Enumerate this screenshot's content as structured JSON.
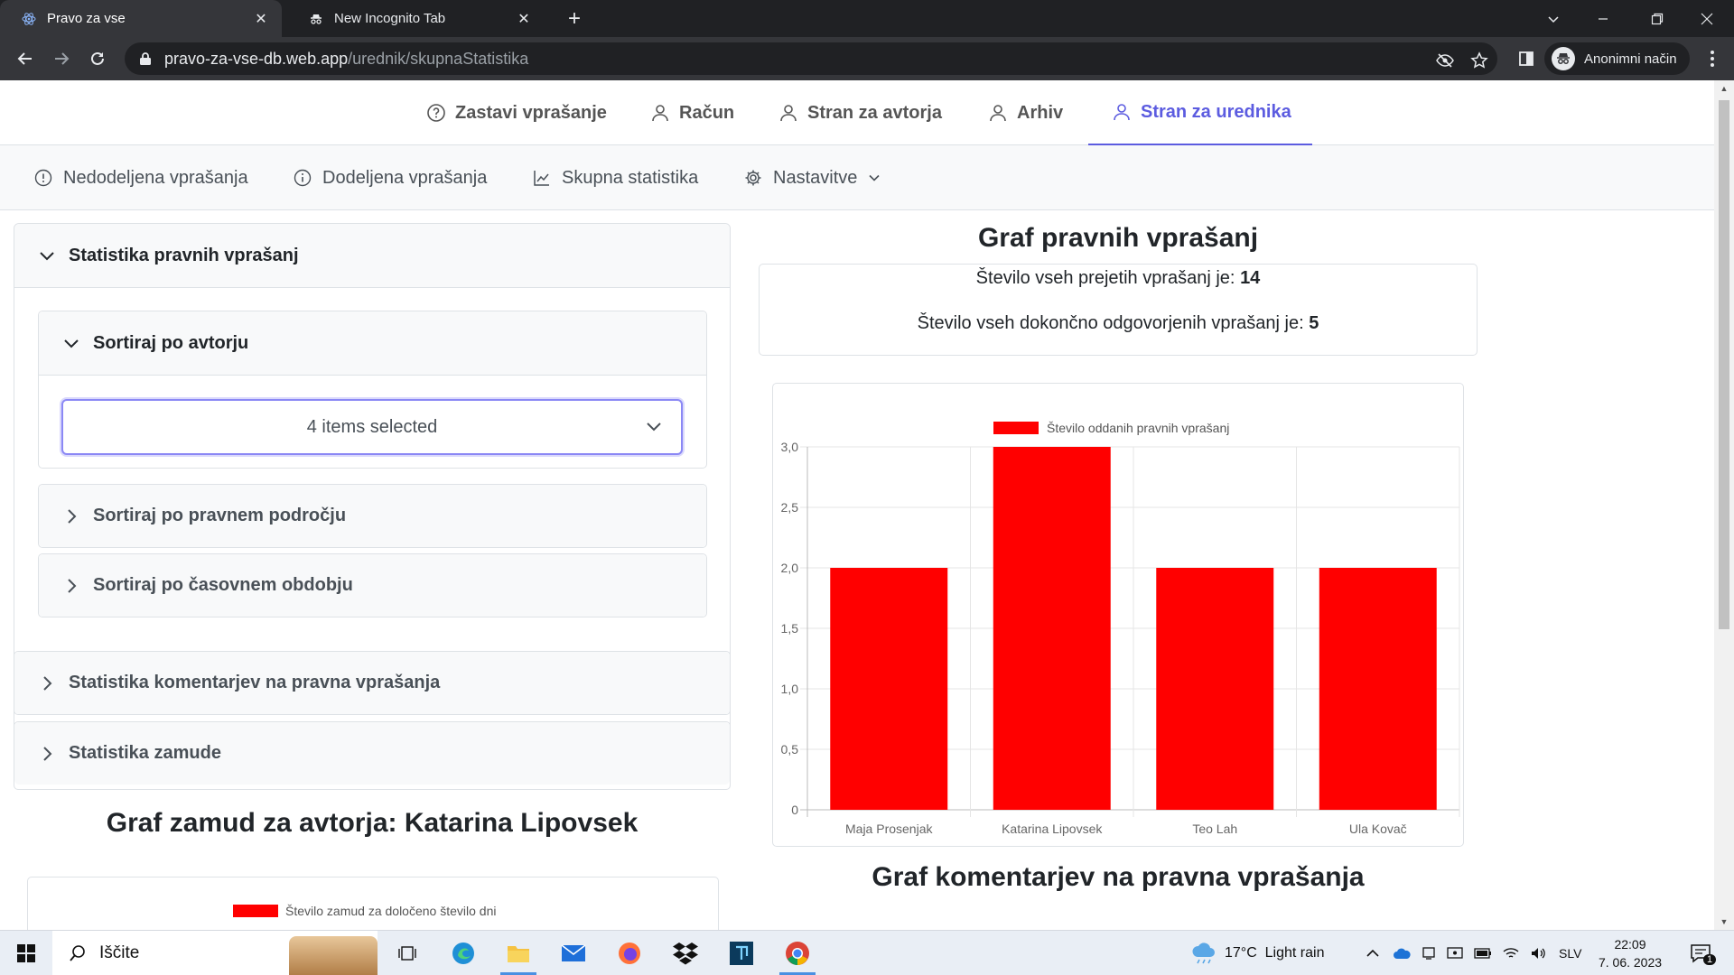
{
  "browser": {
    "tabs": [
      {
        "title": "Pravo za vse",
        "active": true
      },
      {
        "title": "New Incognito Tab",
        "active": false
      }
    ],
    "url_host": "pravo-za-vse-db.web.app",
    "url_path": "/urednik/skupnaStatistika",
    "incognito_label": "Anonimni način"
  },
  "main_nav": [
    {
      "label": "Zastavi vprašanje",
      "icon": "question-circle-icon"
    },
    {
      "label": "Račun",
      "icon": "user-icon"
    },
    {
      "label": "Stran za avtorja",
      "icon": "user-icon"
    },
    {
      "label": "Arhiv",
      "icon": "user-icon"
    },
    {
      "label": "Stran za urednika",
      "icon": "user-icon",
      "active": true
    }
  ],
  "sub_nav": [
    {
      "label": "Nedodeljena vprašanja",
      "icon": "alert-circle-icon"
    },
    {
      "label": "Dodeljena vprašanja",
      "icon": "info-circle-icon"
    },
    {
      "label": "Skupna statistika",
      "icon": "line-chart-icon"
    },
    {
      "label": "Nastavitve",
      "icon": "gear-icon",
      "dropdown": true
    }
  ],
  "accordion": {
    "legal": "Statistika pravnih vprašanj",
    "by_author": "Sortiraj po avtorju",
    "multiselect": "4 items selected",
    "by_area": "Sortiraj po pravnem področju",
    "by_period": "Sortiraj po časovnem obdobju",
    "comments": "Statistika komentarjev na pravna vprašanja",
    "delays": "Statistika zamude"
  },
  "headings": {
    "legal_graph": "Graf pravnih vprašanj",
    "delay_graph": "Graf zamud za avtorja: Katarina Lipovsek",
    "comments_graph": "Graf komentarjev na pravna vprašanja"
  },
  "stats": {
    "received_label": "Število vseh prejetih vprašanj je:",
    "received_value": "14",
    "answered_label": "Število vseh dokončno odgovorjenih vprašanj je:",
    "answered_value": "5"
  },
  "chart_data": {
    "type": "bar",
    "categories": [
      "Maja Prosenjak",
      "Katarina Lipovsek",
      "Teo Lah",
      "Ula Kovač"
    ],
    "series": [
      {
        "name": "Število oddanih pravnih vprašanj",
        "values": [
          2,
          3,
          2,
          2
        ],
        "color": "#ff0000"
      }
    ],
    "ylim": [
      0,
      3
    ],
    "yticks": [
      "0",
      "0,5",
      "1,0",
      "1,5",
      "2,0",
      "2,5",
      "3,0"
    ],
    "grid": true,
    "legend": "top"
  },
  "delay_chart": {
    "legend_label": "Število zamud za določeno število dni",
    "color": "#ff0000"
  },
  "taskbar": {
    "search_label": "Iščite",
    "weather": "17°C  Light rain",
    "lang": "SLV",
    "time": "22:09",
    "date": "7. 06. 2023",
    "notification_count": "1"
  },
  "colors": {
    "accent": "#5c5ce0",
    "bar": "#ff0000"
  }
}
